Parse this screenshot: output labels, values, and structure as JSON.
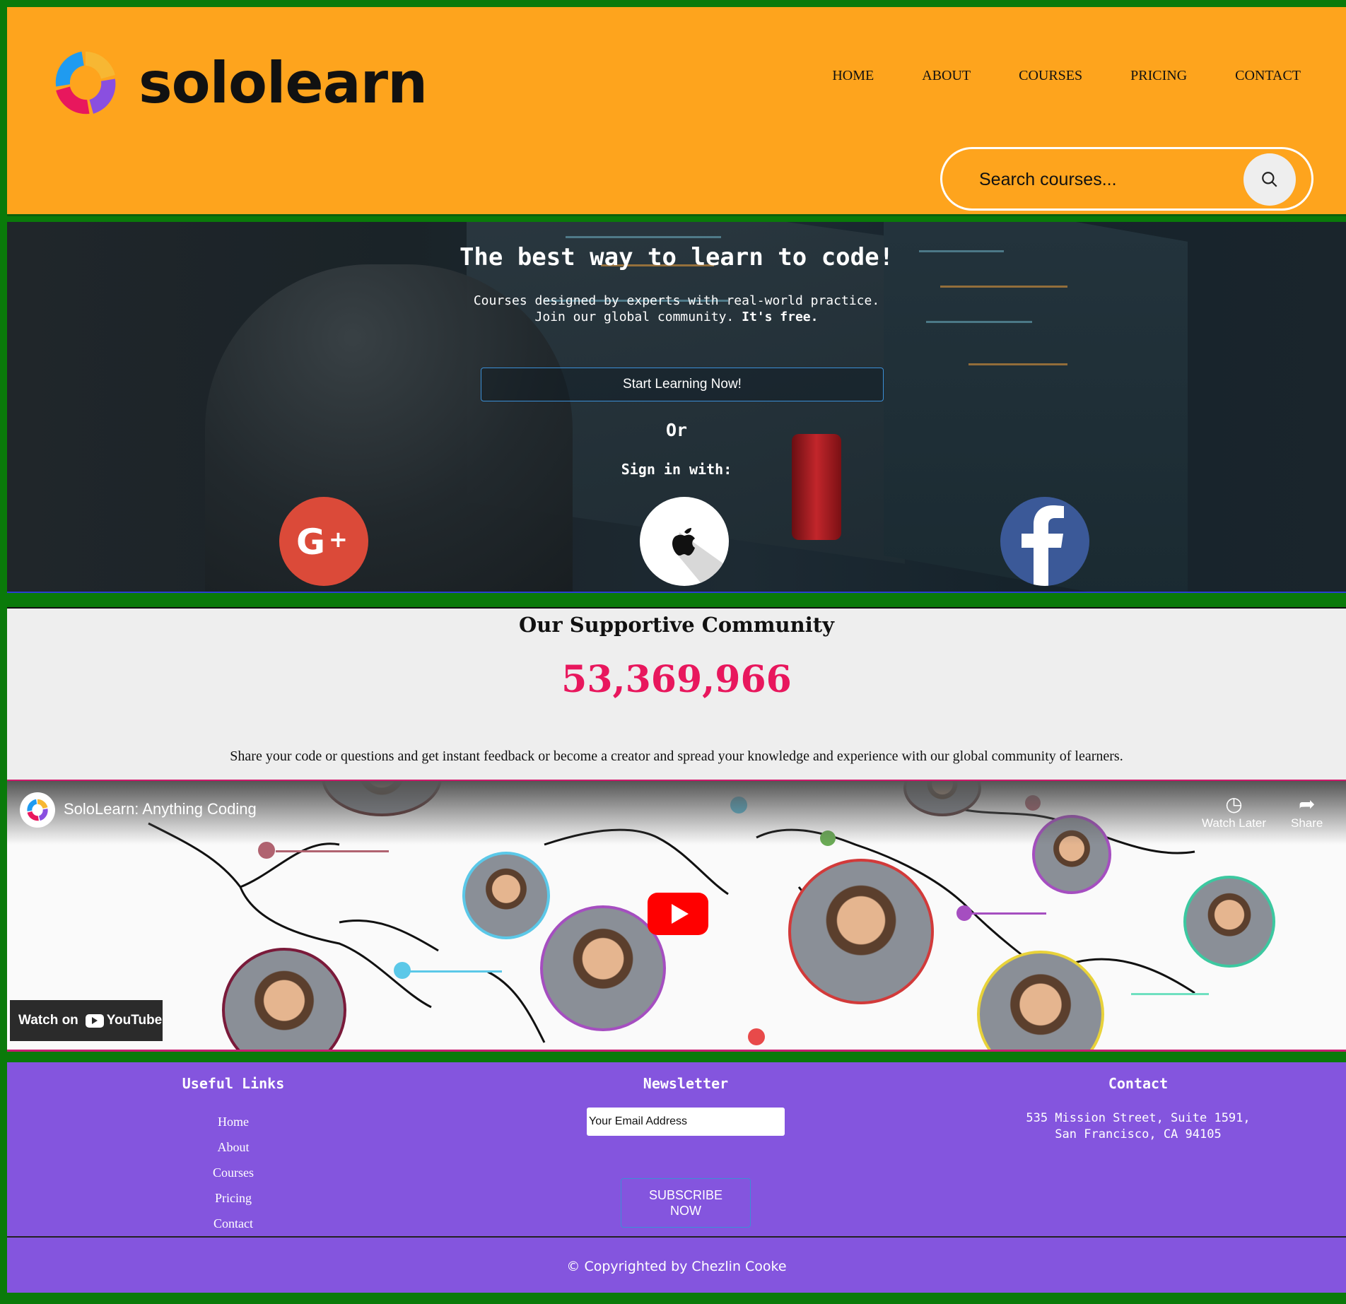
{
  "brand": {
    "name": "sololearn"
  },
  "nav": {
    "items": [
      {
        "label": "HOME"
      },
      {
        "label": "ABOUT"
      },
      {
        "label": "COURSES"
      },
      {
        "label": "PRICING"
      },
      {
        "label": "CONTACT"
      }
    ]
  },
  "search": {
    "placeholder": "Search courses...",
    "icon": "search-icon"
  },
  "hero": {
    "title": "The best way to learn to code!",
    "subtitle_line1": "Courses designed by experts with real-world practice.",
    "subtitle_line2": "Join our global community.",
    "subtitle_bold": "It's free.",
    "cta": "Start Learning Now!",
    "or": "Or",
    "signin": "Sign in with:",
    "social": [
      {
        "name": "google-plus-icon",
        "glyph": "G+"
      },
      {
        "name": "apple-icon"
      },
      {
        "name": "facebook-icon",
        "glyph": "f"
      }
    ]
  },
  "community": {
    "title": "Our Supportive Community",
    "count": "53,369,966",
    "description": "Share your code or questions and get instant feedback or become a creator and spread your knowledge and experience with our global community of learners."
  },
  "video": {
    "title": "SoloLearn: Anything Coding",
    "watch_later": "Watch Later",
    "share": "Share",
    "watch_on": "Watch on",
    "youtube": "YouTube"
  },
  "footer": {
    "links_title": "Useful Links",
    "links": [
      {
        "label": "Home"
      },
      {
        "label": "About"
      },
      {
        "label": "Courses"
      },
      {
        "label": "Pricing"
      },
      {
        "label": "Contact"
      }
    ],
    "newsletter_title": "Newsletter",
    "email_placeholder": "Your Email Address",
    "subscribe_line1": "SUBSCRIBE",
    "subscribe_line2": "NOW",
    "contact_title": "Contact",
    "address_line1": "535 Mission Street, Suite 1591,",
    "address_line2": "San Francisco, CA 94105",
    "copyright": "© Copyrighted by Chezlin Cooke"
  },
  "colors": {
    "header_bg": "#fea41d",
    "footer_bg": "#8455de",
    "counter": "#e8175d",
    "page_border": "#0a7a0a"
  }
}
